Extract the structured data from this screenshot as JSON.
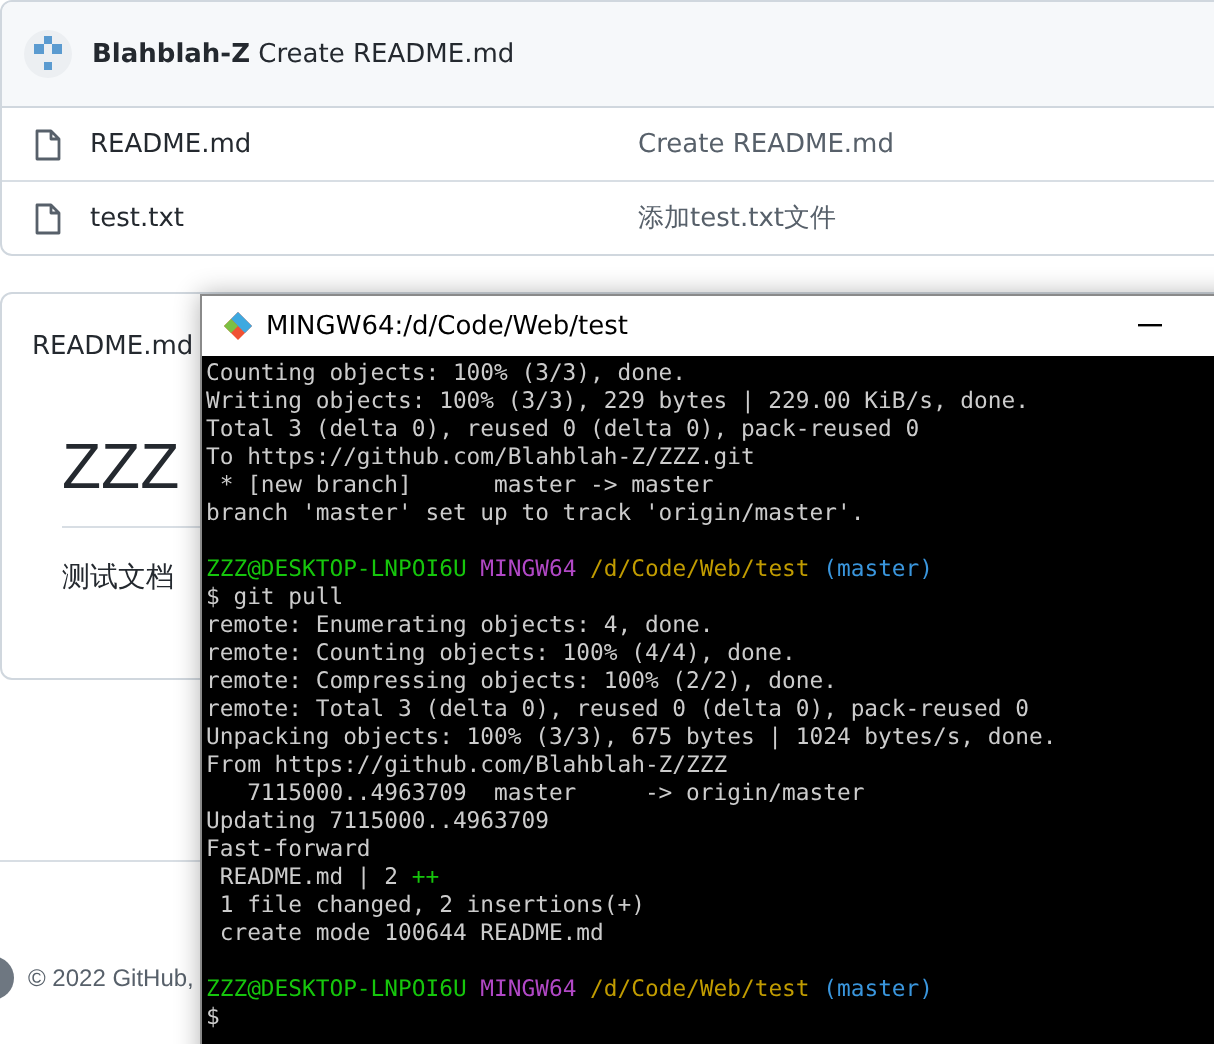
{
  "commit": {
    "author": "Blahblah-Z",
    "message": "Create README.md"
  },
  "files": [
    {
      "name": "README.md",
      "message": "Create README.md"
    },
    {
      "name": "test.txt",
      "message": "添加test.txt文件"
    }
  ],
  "readme": {
    "title": "README.md",
    "heading": "ZZZ",
    "text": "测试文档"
  },
  "footer": {
    "copyright": "© 2022 GitHub,"
  },
  "terminal": {
    "title": "MINGW64:/d/Code/Web/test",
    "lines": [
      {
        "kind": "output",
        "segments": [
          {
            "text": "Counting objects: 100% (3/3), done.",
            "color": "#cccccc"
          }
        ]
      },
      {
        "kind": "output",
        "segments": [
          {
            "text": "Writing objects: 100% (3/3), 229 bytes | 229.00 KiB/s, done.",
            "color": "#cccccc"
          }
        ]
      },
      {
        "kind": "output",
        "segments": [
          {
            "text": "Total 3 (delta 0), reused 0 (delta 0), pack-reused 0",
            "color": "#cccccc"
          }
        ]
      },
      {
        "kind": "output",
        "segments": [
          {
            "text": "To https://github.com/Blahblah-Z/ZZZ.git",
            "color": "#cccccc"
          }
        ]
      },
      {
        "kind": "output",
        "segments": [
          {
            "text": " * [new branch]      master -> master",
            "color": "#cccccc"
          }
        ]
      },
      {
        "kind": "output",
        "segments": [
          {
            "text": "branch 'master' set up to track 'origin/master'.",
            "color": "#cccccc"
          }
        ]
      },
      {
        "kind": "blank"
      },
      {
        "kind": "output",
        "segments": [
          {
            "text": "ZZZ@DESKTOP-LNPOI6U",
            "color": "#16c60c"
          },
          {
            "text": " MINGW64",
            "color": "#b148c6"
          },
          {
            "text": " /d/Code/Web/test",
            "color": "#c19c00"
          },
          {
            "text": " (master)",
            "color": "#3a96dd"
          }
        ]
      },
      {
        "kind": "output",
        "segments": [
          {
            "text": "$ git pull",
            "color": "#cccccc"
          }
        ]
      },
      {
        "kind": "output",
        "segments": [
          {
            "text": "remote: Enumerating objects: 4, done.",
            "color": "#cccccc"
          }
        ]
      },
      {
        "kind": "output",
        "segments": [
          {
            "text": "remote: Counting objects: 100% (4/4), done.",
            "color": "#cccccc"
          }
        ]
      },
      {
        "kind": "output",
        "segments": [
          {
            "text": "remote: Compressing objects: 100% (2/2), done.",
            "color": "#cccccc"
          }
        ]
      },
      {
        "kind": "output",
        "segments": [
          {
            "text": "remote: Total 3 (delta 0), reused 0 (delta 0), pack-reused 0",
            "color": "#cccccc"
          }
        ]
      },
      {
        "kind": "output",
        "segments": [
          {
            "text": "Unpacking objects: 100% (3/3), 675 bytes | 1024 bytes/s, done.",
            "color": "#cccccc"
          }
        ]
      },
      {
        "kind": "output",
        "segments": [
          {
            "text": "From https://github.com/Blahblah-Z/ZZZ",
            "color": "#cccccc"
          }
        ]
      },
      {
        "kind": "output",
        "segments": [
          {
            "text": "   7115000..4963709  master     -> origin/master",
            "color": "#cccccc"
          }
        ]
      },
      {
        "kind": "output",
        "segments": [
          {
            "text": "Updating 7115000..4963709",
            "color": "#cccccc"
          }
        ]
      },
      {
        "kind": "output",
        "segments": [
          {
            "text": "Fast-forward",
            "color": "#cccccc"
          }
        ]
      },
      {
        "kind": "output",
        "segments": [
          {
            "text": " README.md | 2 ",
            "color": "#cccccc"
          },
          {
            "text": "++",
            "color": "#16c60c"
          }
        ]
      },
      {
        "kind": "output",
        "segments": [
          {
            "text": " 1 file changed, 2 insertions(+)",
            "color": "#cccccc"
          }
        ]
      },
      {
        "kind": "output",
        "segments": [
          {
            "text": " create mode 100644 README.md",
            "color": "#cccccc"
          }
        ]
      },
      {
        "kind": "blank"
      },
      {
        "kind": "output",
        "segments": [
          {
            "text": "ZZZ@DESKTOP-LNPOI6U",
            "color": "#16c60c"
          },
          {
            "text": " MINGW64",
            "color": "#b148c6"
          },
          {
            "text": " /d/Code/Web/test",
            "color": "#c19c00"
          },
          {
            "text": " (master)",
            "color": "#3a96dd"
          }
        ]
      },
      {
        "kind": "output",
        "segments": [
          {
            "text": "$",
            "color": "#cccccc"
          }
        ]
      }
    ]
  }
}
